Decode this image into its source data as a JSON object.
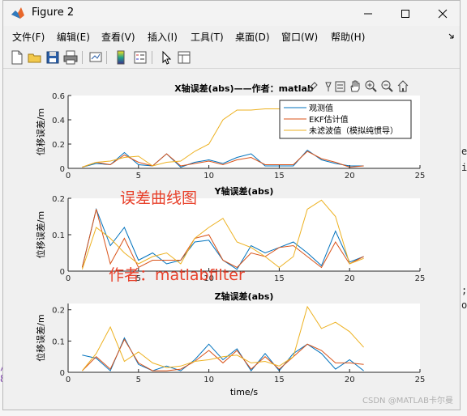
{
  "window": {
    "title": "Figure 2"
  },
  "menu": [
    "文件(F)",
    "编辑(E)",
    "查看(V)",
    "插入(I)",
    "工具(T)",
    "桌面(D)",
    "窗口(W)",
    "帮助(H)"
  ],
  "toolbar_icons": [
    "new-figure-icon",
    "open-file-icon",
    "save-icon",
    "print-icon",
    "link-plot-icon",
    "insert-colorbar-icon",
    "insert-legend-icon",
    "edit-plot-icon",
    "property-inspector-icon"
  ],
  "axes_toolbar_icons": [
    "brush-icon",
    "data-cursor-icon",
    "pan-icon",
    "zoom-in-icon",
    "zoom-out-icon",
    "home-icon"
  ],
  "background_chars": [
    "e",
    "i",
    ";",
    "o",
    "/",
    "8"
  ],
  "watermarks": {
    "curve": "误差曲线图",
    "author": "作者：matlabfilter",
    "csdn": "CSDN @MATLAB卡尔曼"
  },
  "colors": {
    "observed": "#0072bd",
    "ekf": "#d95319",
    "unfiltered": "#edb120"
  },
  "chart_data": [
    {
      "type": "line",
      "title": "X轴误差(abs)——作者：matlab",
      "ylabel": "位移误差/m",
      "xlim": [
        0,
        25
      ],
      "ylim": [
        0,
        0.6
      ],
      "xticks": [
        0,
        5,
        10,
        15,
        20,
        25
      ],
      "yticks": [
        0,
        0.2,
        0.4,
        0.6
      ],
      "tick_labels_y": [
        "0",
        "0.2",
        "0.4",
        "0.6"
      ],
      "legend": "top-right",
      "x": [
        1,
        2,
        3,
        4,
        5,
        6,
        7,
        8,
        9,
        10,
        11,
        12,
        13,
        14,
        15,
        16,
        17,
        18,
        19,
        20,
        21
      ],
      "series": [
        {
          "name": "观测值",
          "values": [
            0.01,
            0.04,
            0.03,
            0.13,
            0.03,
            0.02,
            0.12,
            0.01,
            0.05,
            0.07,
            0.04,
            0.09,
            0.12,
            0.02,
            0.02,
            0.02,
            0.15,
            0.07,
            0.04,
            0.02,
            0.02
          ]
        },
        {
          "name": "EKF估计值",
          "values": [
            0.01,
            0.05,
            0.03,
            0.11,
            0.05,
            0.02,
            0.12,
            0.02,
            0.04,
            0.06,
            0.03,
            0.07,
            0.09,
            0.03,
            0.03,
            0.03,
            0.14,
            0.08,
            0.05,
            0.01,
            0.02
          ]
        },
        {
          "name": "未滤波值（模拟纯惯导）",
          "values": [
            0.01,
            0.05,
            0.06,
            0.09,
            0.1,
            0.02,
            0.05,
            0.06,
            0.14,
            0.2,
            0.4,
            0.48,
            0.48,
            0.49,
            0.49,
            0.49,
            0.49,
            0.49,
            0.49,
            0.49,
            0.49
          ]
        }
      ]
    },
    {
      "type": "line",
      "title": "Y轴误差(abs)",
      "ylabel": "位移误差/m",
      "xlim": [
        0,
        25
      ],
      "ylim": [
        0,
        0.2
      ],
      "xticks": [
        0,
        5,
        10,
        15,
        20,
        25
      ],
      "yticks": [
        0,
        0.1,
        0.2
      ],
      "tick_labels_y": [
        "0",
        "0.1",
        "0.2"
      ],
      "x": [
        1,
        2,
        3,
        4,
        5,
        6,
        7,
        8,
        9,
        10,
        11,
        12,
        13,
        14,
        15,
        16,
        17,
        18,
        19,
        20,
        21
      ],
      "series": [
        {
          "name": "观测值",
          "values": [
            0.01,
            0.17,
            0.07,
            0.12,
            0.03,
            0.05,
            0.02,
            0.03,
            0.08,
            0.085,
            0.03,
            0.005,
            0.07,
            0.05,
            0.065,
            0.08,
            0.05,
            0.015,
            0.11,
            0.025,
            0.04
          ]
        },
        {
          "name": "EKF估计值",
          "values": [
            0.01,
            0.17,
            0.02,
            0.09,
            0.01,
            0.03,
            0.03,
            0.03,
            0.09,
            0.1,
            0.03,
            0.01,
            0.05,
            0.04,
            0.065,
            0.07,
            0.04,
            0.01,
            0.08,
            0.02,
            0.04
          ]
        },
        {
          "name": "未滤波值（模拟纯惯导）",
          "values": [
            0.005,
            0.12,
            0.09,
            0.05,
            0.02,
            0.04,
            0.05,
            0.02,
            0.09,
            0.12,
            0.145,
            0.08,
            0.065,
            0.04,
            0.01,
            0.04,
            0.17,
            0.195,
            0.15,
            0.02,
            0.035
          ]
        }
      ]
    },
    {
      "type": "line",
      "title": "Z轴误差(abs)",
      "ylabel": "位移误差/m",
      "xlabel": "time/s",
      "xlim": [
        0,
        25
      ],
      "ylim": [
        0,
        0.22
      ],
      "xticks": [
        0,
        5,
        10,
        15,
        20,
        25
      ],
      "yticks": [
        0,
        0.1,
        0.2
      ],
      "tick_labels_y": [
        "0",
        "0.1",
        "0.2"
      ],
      "x": [
        1,
        2,
        3,
        4,
        5,
        6,
        7,
        8,
        9,
        10,
        11,
        12,
        13,
        14,
        15,
        16,
        17,
        18,
        19,
        20,
        21
      ],
      "series": [
        {
          "name": "观测值",
          "values": [
            0.055,
            0.045,
            0.005,
            0.11,
            0.025,
            0.005,
            0.02,
            0.005,
            0.04,
            0.09,
            0.04,
            0.075,
            0.005,
            0.06,
            0.005,
            0.06,
            0.09,
            0.06,
            0.01,
            0.04,
            0.005
          ]
        },
        {
          "name": "EKF估计值",
          "values": [
            0.005,
            0.05,
            0.01,
            0.105,
            0.03,
            0.005,
            0.005,
            0.01,
            0.035,
            0.07,
            0.03,
            0.07,
            0.01,
            0.05,
            0.01,
            0.05,
            0.09,
            0.07,
            0.03,
            0.03,
            0.025
          ]
        },
        {
          "name": "未滤波值（模拟纯惯导）",
          "values": [
            0.005,
            0.06,
            0.145,
            0.035,
            0.065,
            0.03,
            0.015,
            0.02,
            0.035,
            0.04,
            0.05,
            0.055,
            0.03,
            0.035,
            0.02,
            0.05,
            0.21,
            0.14,
            0.16,
            0.13,
            0.08
          ]
        }
      ]
    }
  ]
}
